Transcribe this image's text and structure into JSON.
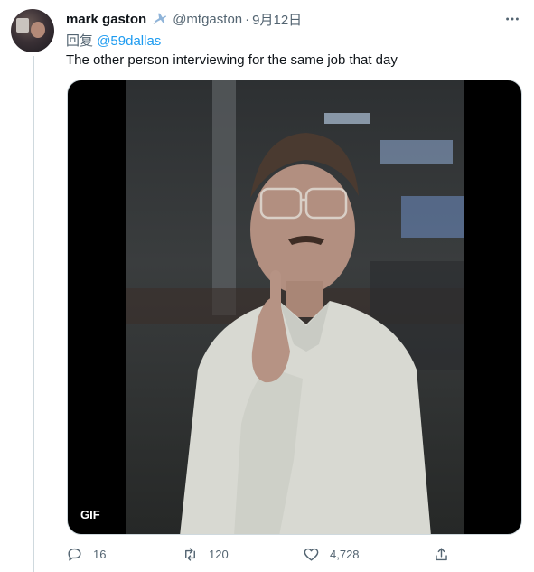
{
  "tweet": {
    "display_name": "mark gaston",
    "verified_icon": "airplane-emoji",
    "handle": "@mtgaston",
    "separator": "·",
    "timestamp": "9月12日",
    "reply_prefix": "回复",
    "reply_to": "@59dallas",
    "text": "The other person interviewing for the same job that day",
    "media_badge": "GIF"
  },
  "actions": {
    "reply_count": "16",
    "retweet_count": "120",
    "like_count": "4,728"
  },
  "colors": {
    "accent": "#1d9bf0",
    "secondary_text": "#536471",
    "primary_text": "#0f1419"
  }
}
